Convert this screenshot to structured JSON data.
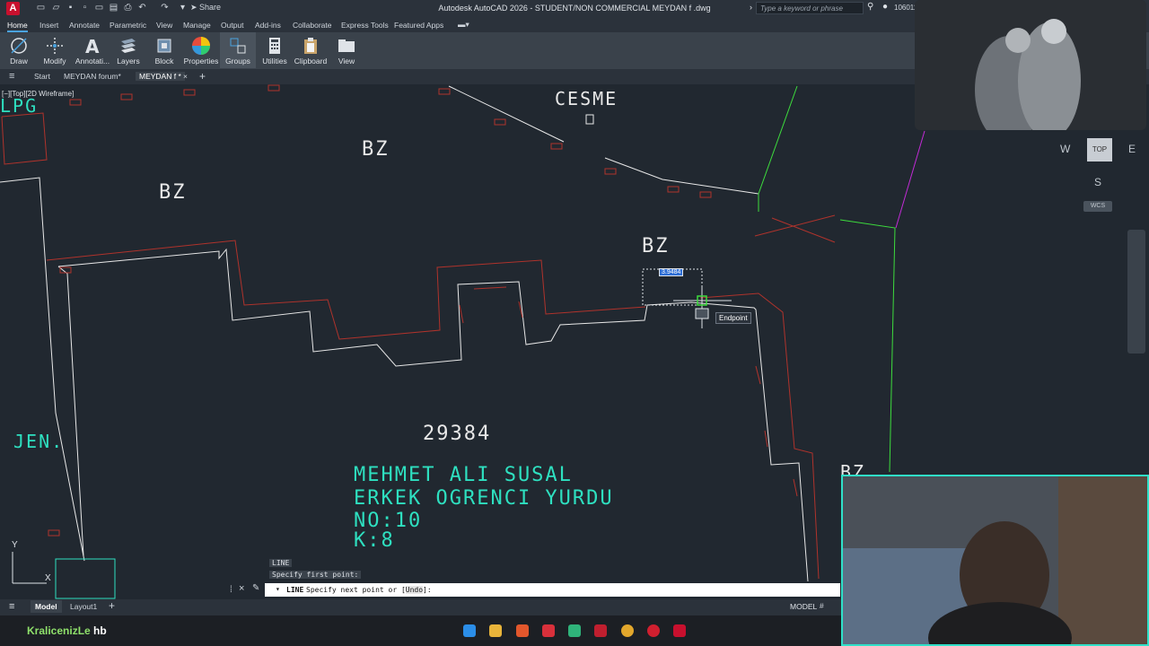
{
  "window": {
    "title": "Autodesk AutoCAD 2026 - STUDENT/NON COMMERCIAL   MEYDAN f .dwg",
    "app_logo": "A",
    "share_label": "Share",
    "search_placeholder": "Type a keyword or phrase",
    "user_count": "106011"
  },
  "ribbon_tabs": [
    "Home",
    "Insert",
    "Annotate",
    "Parametric",
    "View",
    "Manage",
    "Output",
    "Add-ins",
    "Collaborate",
    "Express Tools",
    "Featured Apps"
  ],
  "ribbon_panels": [
    "Draw",
    "Modify",
    "Annotati...",
    "Layers",
    "Block",
    "Properties",
    "Groups",
    "Utilities",
    "Clipboard",
    "View"
  ],
  "file_tabs": {
    "start": "Start",
    "tab1": "MEYDAN forum*",
    "tab2": "MEYDAN f *"
  },
  "viewport_label": "[−][Top][2D Wireframe]",
  "drawing_text": {
    "lpg": "LPG",
    "cesme": "CESME",
    "bz1": "BZ",
    "bz2": "BZ",
    "bz3": "BZ",
    "bz4": "BZ",
    "jen": "JEN.",
    "parcel": "29384",
    "line1": "MEHMET ALI SUSAL",
    "line2": "ERKEK OGRENCI YURDU",
    "line3": "NO:10",
    "line4": "K:8"
  },
  "dynamic_input": "3.9484",
  "snap_tooltip": "Endpoint",
  "viewcube": {
    "top": "TOP",
    "west": "W",
    "east": "E",
    "south": "S",
    "wcs": "WCS"
  },
  "command": {
    "history1": "LINE",
    "history2": "Specify first point:",
    "prompt_cmd": "LINE",
    "prompt_text": "Specify next point or [",
    "prompt_option": "Undo",
    "prompt_end": "]:"
  },
  "status": {
    "model_tab": "Model",
    "layout_tab": "Layout1",
    "model_indicator": "MODEL"
  },
  "taskbar": {
    "streamer": "KralicenizLe",
    "tag": "hb"
  },
  "colors": {
    "accent": "#4aa3df",
    "canvas": "#212830",
    "cyan_text": "#2ee0c0",
    "red_lines": "#c0392b",
    "green_lines": "#3ddc3d"
  }
}
